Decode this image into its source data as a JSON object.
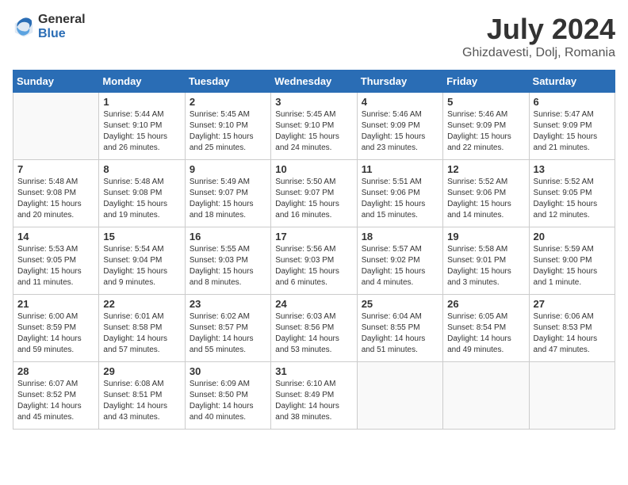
{
  "header": {
    "logo_general": "General",
    "logo_blue": "Blue",
    "month": "July 2024",
    "location": "Ghizdavesti, Dolj, Romania"
  },
  "weekdays": [
    "Sunday",
    "Monday",
    "Tuesday",
    "Wednesday",
    "Thursday",
    "Friday",
    "Saturday"
  ],
  "weeks": [
    [
      {
        "day": null
      },
      {
        "day": "1",
        "sunrise": "Sunrise: 5:44 AM",
        "sunset": "Sunset: 9:10 PM",
        "daylight": "Daylight: 15 hours and 26 minutes."
      },
      {
        "day": "2",
        "sunrise": "Sunrise: 5:45 AM",
        "sunset": "Sunset: 9:10 PM",
        "daylight": "Daylight: 15 hours and 25 minutes."
      },
      {
        "day": "3",
        "sunrise": "Sunrise: 5:45 AM",
        "sunset": "Sunset: 9:10 PM",
        "daylight": "Daylight: 15 hours and 24 minutes."
      },
      {
        "day": "4",
        "sunrise": "Sunrise: 5:46 AM",
        "sunset": "Sunset: 9:09 PM",
        "daylight": "Daylight: 15 hours and 23 minutes."
      },
      {
        "day": "5",
        "sunrise": "Sunrise: 5:46 AM",
        "sunset": "Sunset: 9:09 PM",
        "daylight": "Daylight: 15 hours and 22 minutes."
      },
      {
        "day": "6",
        "sunrise": "Sunrise: 5:47 AM",
        "sunset": "Sunset: 9:09 PM",
        "daylight": "Daylight: 15 hours and 21 minutes."
      }
    ],
    [
      {
        "day": "7",
        "sunrise": "Sunrise: 5:48 AM",
        "sunset": "Sunset: 9:08 PM",
        "daylight": "Daylight: 15 hours and 20 minutes."
      },
      {
        "day": "8",
        "sunrise": "Sunrise: 5:48 AM",
        "sunset": "Sunset: 9:08 PM",
        "daylight": "Daylight: 15 hours and 19 minutes."
      },
      {
        "day": "9",
        "sunrise": "Sunrise: 5:49 AM",
        "sunset": "Sunset: 9:07 PM",
        "daylight": "Daylight: 15 hours and 18 minutes."
      },
      {
        "day": "10",
        "sunrise": "Sunrise: 5:50 AM",
        "sunset": "Sunset: 9:07 PM",
        "daylight": "Daylight: 15 hours and 16 minutes."
      },
      {
        "day": "11",
        "sunrise": "Sunrise: 5:51 AM",
        "sunset": "Sunset: 9:06 PM",
        "daylight": "Daylight: 15 hours and 15 minutes."
      },
      {
        "day": "12",
        "sunrise": "Sunrise: 5:52 AM",
        "sunset": "Sunset: 9:06 PM",
        "daylight": "Daylight: 15 hours and 14 minutes."
      },
      {
        "day": "13",
        "sunrise": "Sunrise: 5:52 AM",
        "sunset": "Sunset: 9:05 PM",
        "daylight": "Daylight: 15 hours and 12 minutes."
      }
    ],
    [
      {
        "day": "14",
        "sunrise": "Sunrise: 5:53 AM",
        "sunset": "Sunset: 9:05 PM",
        "daylight": "Daylight: 15 hours and 11 minutes."
      },
      {
        "day": "15",
        "sunrise": "Sunrise: 5:54 AM",
        "sunset": "Sunset: 9:04 PM",
        "daylight": "Daylight: 15 hours and 9 minutes."
      },
      {
        "day": "16",
        "sunrise": "Sunrise: 5:55 AM",
        "sunset": "Sunset: 9:03 PM",
        "daylight": "Daylight: 15 hours and 8 minutes."
      },
      {
        "day": "17",
        "sunrise": "Sunrise: 5:56 AM",
        "sunset": "Sunset: 9:03 PM",
        "daylight": "Daylight: 15 hours and 6 minutes."
      },
      {
        "day": "18",
        "sunrise": "Sunrise: 5:57 AM",
        "sunset": "Sunset: 9:02 PM",
        "daylight": "Daylight: 15 hours and 4 minutes."
      },
      {
        "day": "19",
        "sunrise": "Sunrise: 5:58 AM",
        "sunset": "Sunset: 9:01 PM",
        "daylight": "Daylight: 15 hours and 3 minutes."
      },
      {
        "day": "20",
        "sunrise": "Sunrise: 5:59 AM",
        "sunset": "Sunset: 9:00 PM",
        "daylight": "Daylight: 15 hours and 1 minute."
      }
    ],
    [
      {
        "day": "21",
        "sunrise": "Sunrise: 6:00 AM",
        "sunset": "Sunset: 8:59 PM",
        "daylight": "Daylight: 14 hours and 59 minutes."
      },
      {
        "day": "22",
        "sunrise": "Sunrise: 6:01 AM",
        "sunset": "Sunset: 8:58 PM",
        "daylight": "Daylight: 14 hours and 57 minutes."
      },
      {
        "day": "23",
        "sunrise": "Sunrise: 6:02 AM",
        "sunset": "Sunset: 8:57 PM",
        "daylight": "Daylight: 14 hours and 55 minutes."
      },
      {
        "day": "24",
        "sunrise": "Sunrise: 6:03 AM",
        "sunset": "Sunset: 8:56 PM",
        "daylight": "Daylight: 14 hours and 53 minutes."
      },
      {
        "day": "25",
        "sunrise": "Sunrise: 6:04 AM",
        "sunset": "Sunset: 8:55 PM",
        "daylight": "Daylight: 14 hours and 51 minutes."
      },
      {
        "day": "26",
        "sunrise": "Sunrise: 6:05 AM",
        "sunset": "Sunset: 8:54 PM",
        "daylight": "Daylight: 14 hours and 49 minutes."
      },
      {
        "day": "27",
        "sunrise": "Sunrise: 6:06 AM",
        "sunset": "Sunset: 8:53 PM",
        "daylight": "Daylight: 14 hours and 47 minutes."
      }
    ],
    [
      {
        "day": "28",
        "sunrise": "Sunrise: 6:07 AM",
        "sunset": "Sunset: 8:52 PM",
        "daylight": "Daylight: 14 hours and 45 minutes."
      },
      {
        "day": "29",
        "sunrise": "Sunrise: 6:08 AM",
        "sunset": "Sunset: 8:51 PM",
        "daylight": "Daylight: 14 hours and 43 minutes."
      },
      {
        "day": "30",
        "sunrise": "Sunrise: 6:09 AM",
        "sunset": "Sunset: 8:50 PM",
        "daylight": "Daylight: 14 hours and 40 minutes."
      },
      {
        "day": "31",
        "sunrise": "Sunrise: 6:10 AM",
        "sunset": "Sunset: 8:49 PM",
        "daylight": "Daylight: 14 hours and 38 minutes."
      },
      {
        "day": null
      },
      {
        "day": null
      },
      {
        "day": null
      }
    ]
  ]
}
